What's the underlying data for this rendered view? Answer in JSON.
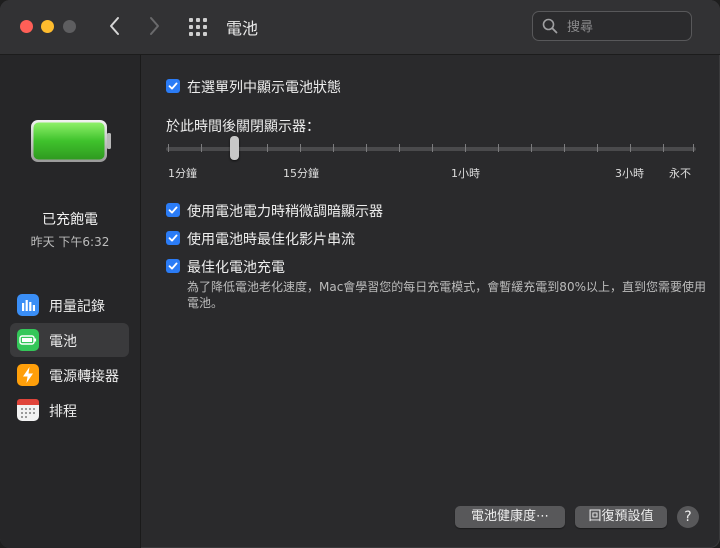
{
  "window": {
    "title": "電池",
    "search_placeholder": "搜尋"
  },
  "sidebar": {
    "battery_status": "已充飽電",
    "battery_time": "昨天 下午6:32",
    "items": [
      {
        "label": "用量記錄",
        "icon": "bar-chart-icon",
        "color": "#3a8ef6"
      },
      {
        "label": "電池",
        "icon": "battery-icon",
        "color": "#34c759",
        "selected": true
      },
      {
        "label": "電源轉接器",
        "icon": "lightning-icon",
        "color": "#ff9f0a"
      },
      {
        "label": "排程",
        "icon": "calendar-icon",
        "color": "#f2f2f2"
      }
    ]
  },
  "main": {
    "show_in_menubar": {
      "label": "在選單列中顯示電池狀態",
      "checked": true
    },
    "display_off_label": "於此時間後關閉顯示器：",
    "slider": {
      "value": "2分鐘",
      "labels": [
        "1分鐘",
        "15分鐘",
        "1小時",
        "3小時",
        "永不"
      ]
    },
    "dim_display": {
      "label": "使用電池電力時稍微調暗顯示器",
      "checked": true
    },
    "optimize_video": {
      "label": "使用電池時最佳化影片串流",
      "checked": true
    },
    "optimize_charging": {
      "label": "最佳化電池充電",
      "checked": true,
      "description": "為了降低電池老化速度，Mac會學習您的每日充電模式，會暫緩充電到80%以上，直到您需要使用電池。"
    },
    "battery_health_button": "電池健康度⋯",
    "restore_defaults_button": "回復預設值",
    "help_button": "?"
  },
  "colors": {
    "accent": "#2b7cf6",
    "battery_green": "#4cd137"
  }
}
